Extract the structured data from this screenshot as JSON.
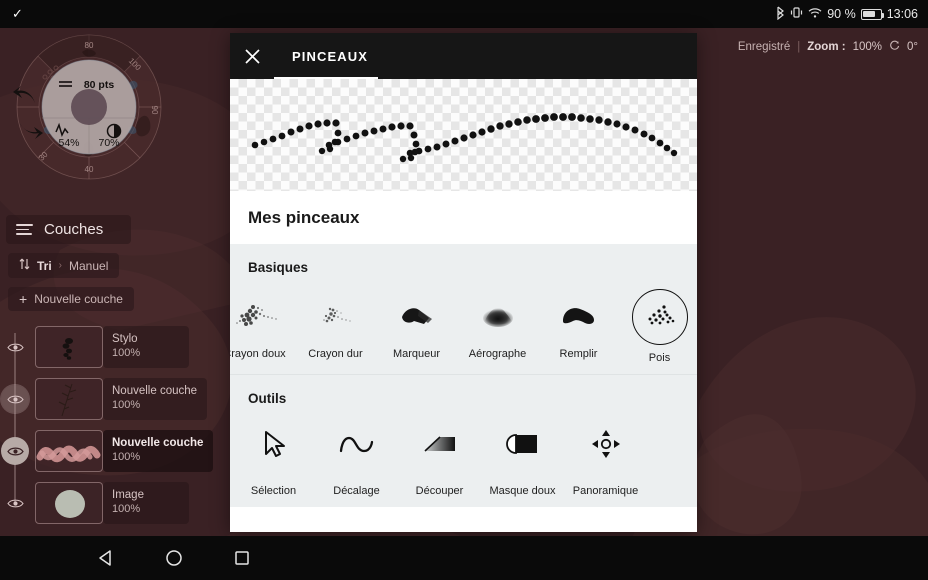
{
  "status_bar": {
    "left_icon": "check-icon",
    "bluetooth_icon": "bluetooth-icon",
    "vibrate_icon": "vibrate-icon",
    "wifi_icon": "wifi-icon",
    "battery_percent": "90 %",
    "battery_icon": "battery-icon",
    "time": "13:06"
  },
  "doc_info": {
    "saved_label": "Enregistré",
    "separator": "|",
    "zoom_label": "Zoom :",
    "zoom_value": "100%",
    "rotate_icon": "rotate-icon",
    "rotation_value": "0°"
  },
  "radial_menu": {
    "size_label": "80 pts",
    "size_icon": "brush-size-icon",
    "jitter_value": "54%",
    "jitter_icon": "jitter-icon",
    "opacity_value": "70%",
    "opacity_icon": "opacity-icon",
    "ring_labels": [
      "80",
      "100",
      "90",
      "30",
      "40"
    ],
    "undo_icon": "undo-arrow-icon",
    "redo_icon": "redo-arrow-icon"
  },
  "layers_panel": {
    "title": "Couches",
    "menu_icon": "hamburger-icon",
    "sort": {
      "icon": "sort-icon",
      "label": "Tri",
      "chevron": "›",
      "value": "Manuel"
    },
    "new_layer": {
      "plus": "+",
      "label": "Nouvelle couche"
    },
    "layers": [
      {
        "name": "Stylo",
        "opacity": "100%",
        "selected": false,
        "visible": true,
        "thumb": "stylo-thumb"
      },
      {
        "name": "Nouvelle couche",
        "opacity": "100%",
        "selected": false,
        "visible": true,
        "thumb": "branch-thumb"
      },
      {
        "name": "Nouvelle couche",
        "opacity": "100%",
        "selected": true,
        "visible": true,
        "thumb": "squiggle-thumb"
      },
      {
        "name": "Image",
        "opacity": "100%",
        "selected": false,
        "visible": true,
        "thumb": "image-thumb"
      }
    ]
  },
  "modal": {
    "close_icon": "close-icon",
    "tab_label": "PINCEAUX",
    "preview_alt": "brush-stroke-preview",
    "my_brushes_title": "Mes pinceaux",
    "sections": [
      {
        "title": "Basiques",
        "items": [
          {
            "label": "Crayon doux",
            "icon": "soft-pencil-icon",
            "selected": false
          },
          {
            "label": "Crayon dur",
            "icon": "hard-pencil-icon",
            "selected": false
          },
          {
            "label": "Marqueur",
            "icon": "marker-icon",
            "selected": false
          },
          {
            "label": "Aérographe",
            "icon": "airbrush-icon",
            "selected": false
          },
          {
            "label": "Remplir",
            "icon": "fill-icon",
            "selected": false
          },
          {
            "label": "Pois",
            "icon": "dots-icon",
            "selected": true
          }
        ]
      },
      {
        "title": "Outils",
        "items": [
          {
            "label": "Sélection",
            "icon": "cursor-icon",
            "selected": false
          },
          {
            "label": "Décalage",
            "icon": "wave-icon",
            "selected": false
          },
          {
            "label": "Découper",
            "icon": "crop-gradient-icon",
            "selected": false
          },
          {
            "label": "Masque doux",
            "icon": "soft-mask-icon",
            "selected": false
          },
          {
            "label": "Panoramique",
            "icon": "pan-arrows-icon",
            "selected": false
          }
        ]
      }
    ]
  },
  "nav_bar": {
    "back_icon": "back-triangle-icon",
    "home_icon": "home-circle-icon",
    "recents_icon": "recents-square-icon"
  },
  "colors": {
    "canvas_bg": "#3b2225",
    "modal_bg": "#ffffff",
    "modal_header_bg": "#161616",
    "section_bg": "#eceff0",
    "status_bar_bg": "#0a0a0a",
    "accent_text": "#1a1a1a"
  }
}
